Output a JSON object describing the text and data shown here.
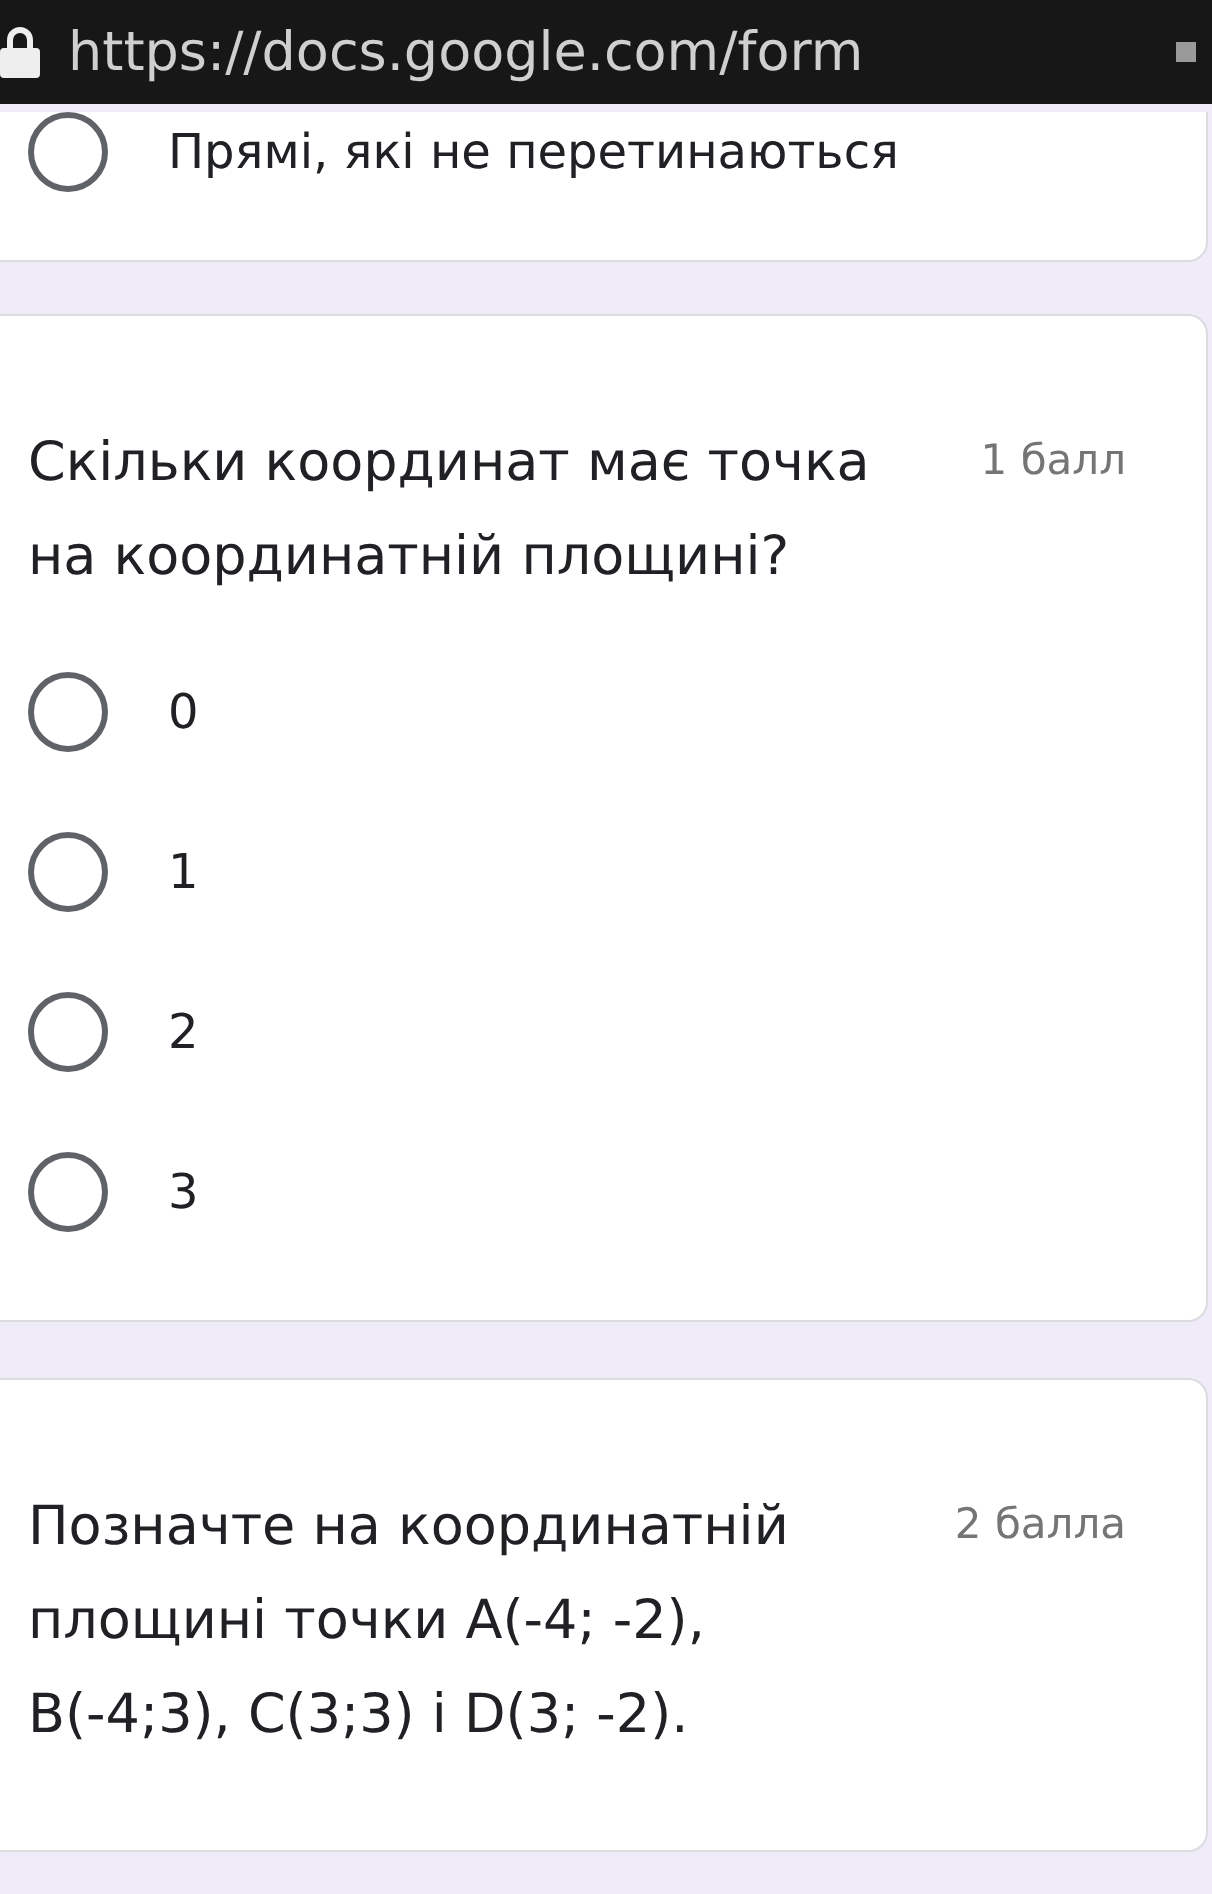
{
  "address_bar": {
    "url": "https://docs.google.com/form"
  },
  "cards": [
    {
      "options": [
        {
          "label": "Прямі, які не перетинаються",
          "selected": false
        }
      ]
    },
    {
      "question": "Скільки координат має точка на координатній площині?",
      "points": "1 балл",
      "options": [
        {
          "label": "0",
          "selected": false
        },
        {
          "label": "1",
          "selected": false
        },
        {
          "label": "2",
          "selected": false
        },
        {
          "label": "3",
          "selected": false
        }
      ]
    },
    {
      "question": "Позначте на координатній площині точки A(-4; -2), B(-4;3), C(3;3) і D(3; -2).",
      "points": "2 балла"
    }
  ]
}
